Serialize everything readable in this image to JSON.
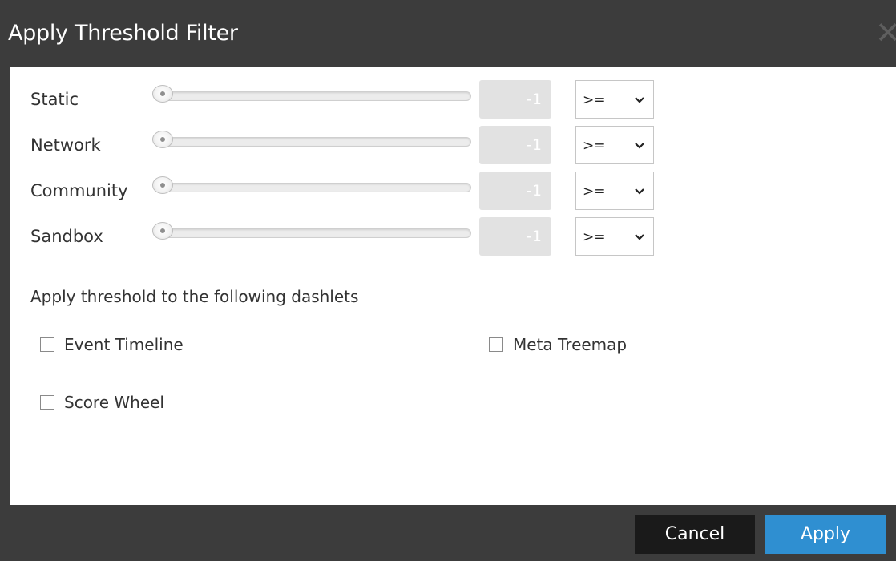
{
  "dialog": {
    "title": "Apply Threshold Filter",
    "close_icon": "close-icon"
  },
  "sliders": [
    {
      "label": "Static",
      "value": "-1",
      "operator": ">="
    },
    {
      "label": "Network",
      "value": "-1",
      "operator": ">="
    },
    {
      "label": "Community",
      "value": "-1",
      "operator": ">="
    },
    {
      "label": "Sandbox",
      "value": "-1",
      "operator": ">="
    }
  ],
  "dashlets": {
    "heading": "Apply threshold to the following dashlets",
    "options": [
      {
        "label": "Event Timeline",
        "checked": false
      },
      {
        "label": "Meta Treemap",
        "checked": false
      },
      {
        "label": "Score Wheel",
        "checked": false
      }
    ]
  },
  "footer": {
    "cancel_label": "Cancel",
    "apply_label": "Apply"
  },
  "colors": {
    "chrome": "#3c3c3c",
    "apply_button": "#2f8fd1",
    "cancel_button": "#1a1a1a",
    "value_box": "#e2e2e2"
  }
}
